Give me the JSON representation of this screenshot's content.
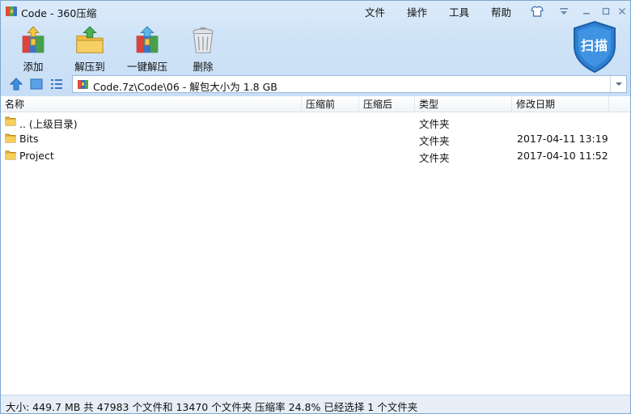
{
  "window": {
    "title": "Code - 360压缩",
    "menu": [
      "文件",
      "操作",
      "工具",
      "帮助"
    ]
  },
  "toolbar": {
    "add_label": "添加",
    "extract_to_label": "解压到",
    "one_click_extract_label": "一键解压",
    "delete_label": "删除",
    "scan_label": "扫描"
  },
  "address": {
    "path": "Code.7z\\Code\\06 - 解包大小为 1.8 GB"
  },
  "columns": {
    "name": "名称",
    "before": "压缩前",
    "after": "压缩后",
    "type": "类型",
    "modified": "修改日期"
  },
  "files": [
    {
      "name": ".. (上级目录)",
      "type": "文件夹",
      "modified": ""
    },
    {
      "name": "Bits",
      "type": "文件夹",
      "modified": "2017-04-11 13:19"
    },
    {
      "name": "Project",
      "type": "文件夹",
      "modified": "2017-04-10 11:52"
    }
  ],
  "status": {
    "text": "大小: 449.7 MB 共 47983 个文件和 13470 个文件夹 压缩率 24.8% 已经选择 1 个文件夹"
  },
  "colors": {
    "accent": "#2f7fd0",
    "folder": "#f2c14e",
    "toolbar_bg": "#cfe3f7"
  }
}
